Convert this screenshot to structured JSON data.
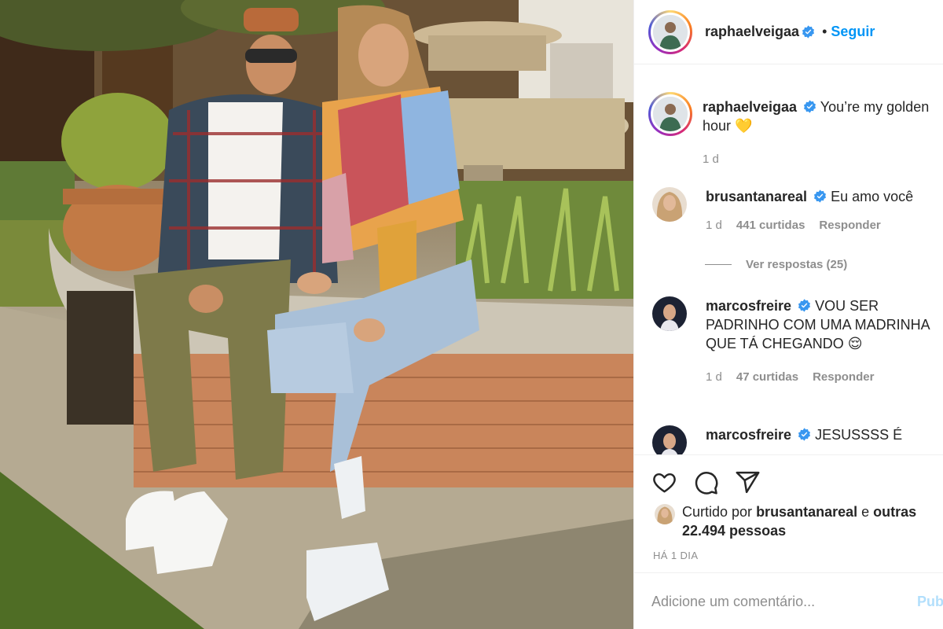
{
  "post": {
    "author": "raphaelveigaa",
    "follow_label": "Seguir",
    "dot": "•",
    "caption": "You’re my golden hour",
    "caption_emoji": "💛",
    "caption_time": "1 d"
  },
  "comments": [
    {
      "user": "brusantanareal",
      "text": "Eu amo você",
      "time": "1 d",
      "likes": "441 curtidas",
      "reply": "Responder"
    },
    {
      "user": "marcosfreire",
      "text": "VOU SER PADRINHO COM UMA MADRINHA QUE TÁ CHEGANDO",
      "emoji": "😌",
      "time": "1 d",
      "likes": "47 curtidas",
      "reply": "Responder"
    },
    {
      "user": "marcosfreire",
      "text": "JESUSSSS É"
    }
  ],
  "view_replies": "Ver respostas (25)",
  "liked_by": {
    "prefix": "Curtido por",
    "user": "brusantanareal",
    "conj": "e",
    "others": "outras 22.494 pessoas"
  },
  "post_date": "HÁ 1 DIA",
  "add_comment": {
    "placeholder": "Adicione um comentário...",
    "publish_label": "Pub"
  },
  "colors": {
    "accent": "#0095f6",
    "muted": "#8e8e8e",
    "text": "#262626",
    "verified": "#3897f0"
  },
  "icons": [
    "heart-icon",
    "comment-icon",
    "share-icon",
    "verified-badge-icon"
  ]
}
